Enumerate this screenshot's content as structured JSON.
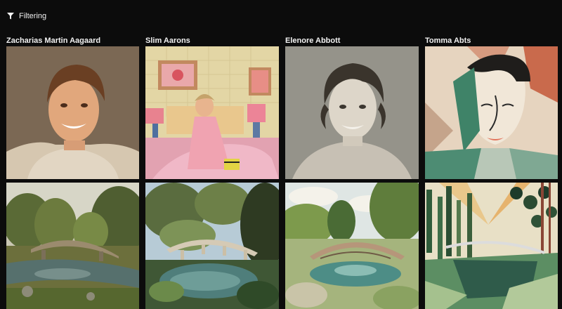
{
  "toolbar": {
    "filter_label": "Filtering",
    "filter_icon": "funnel-icon"
  },
  "artists": [
    {
      "name": "Zacharias Martin Aagaard",
      "portrait_style": "realistic-photo-color",
      "landscape_style": "romantic-painting"
    },
    {
      "name": "Slim Aarons",
      "portrait_style": "pink-bedroom-photo",
      "landscape_style": "garden-photo"
    },
    {
      "name": "Elenore Abbott",
      "portrait_style": "sepia-photo",
      "landscape_style": "illustration"
    },
    {
      "name": "Tomma Abts",
      "portrait_style": "geometric-abstract",
      "landscape_style": "geometric-abstract"
    }
  ],
  "colors": {
    "background": "#0c0c0c",
    "text": "#f2f2f2"
  }
}
